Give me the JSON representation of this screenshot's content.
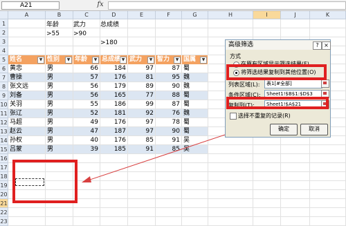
{
  "formula_bar": {
    "cell_ref": "A21",
    "fx": "fx"
  },
  "columns": [
    "A",
    "B",
    "C",
    "D",
    "E",
    "F",
    "G",
    "H",
    "I",
    "J",
    "K"
  ],
  "selected_column": "I",
  "rows": [
    "1",
    "2",
    "3",
    "4",
    "5",
    "6",
    "7",
    "8",
    "9",
    "10",
    "11",
    "12",
    "13",
    "14",
    "15",
    "16",
    "17",
    "18",
    "19",
    "20",
    "21",
    "22",
    "23"
  ],
  "selected_row": "21",
  "criteria": {
    "age_label": "年龄",
    "force_label": "武力",
    "total_label": "总成绩",
    "age_value": ">55",
    "force_value": ">90",
    "total_value": ">180"
  },
  "table": {
    "headers": [
      "姓名",
      "性别",
      "年龄",
      "总成绩",
      "武力",
      "智力",
      "国属"
    ],
    "rows": [
      [
        "黄忠",
        "男",
        "66",
        "184",
        "97",
        "87",
        "蜀"
      ],
      [
        "曹操",
        "男",
        "57",
        "176",
        "81",
        "95",
        "魏"
      ],
      [
        "张文远",
        "男",
        "56",
        "179",
        "89",
        "90",
        "魏"
      ],
      [
        "刘备",
        "男",
        "56",
        "165",
        "77",
        "88",
        "蜀"
      ],
      [
        "关羽",
        "男",
        "55",
        "186",
        "99",
        "87",
        "蜀"
      ],
      [
        "张辽",
        "男",
        "52",
        "181",
        "92",
        "76",
        "魏"
      ],
      [
        "马超",
        "男",
        "49",
        "176",
        "97",
        "78",
        "蜀"
      ],
      [
        "赵云",
        "男",
        "47",
        "187",
        "97",
        "90",
        "蜀"
      ],
      [
        "孙权",
        "男",
        "40",
        "176",
        "85",
        "91",
        "吴"
      ],
      [
        "吕蒙",
        "男",
        "39",
        "185",
        "91",
        "85",
        "吴"
      ]
    ]
  },
  "dialog": {
    "title": "高级筛选",
    "help": "?",
    "close": "×",
    "method_label": "方式",
    "option1": "在原有区域显示筛选结果(F)",
    "option2": "将筛选结果复制到其他位置(O)",
    "list_range_label": "列表区域(L):",
    "list_range_value": "表1[#全部]",
    "criteria_range_label": "条件区域(C):",
    "criteria_range_value": "Sheet1!$B$1:$D$3",
    "copy_to_label": "复制到(T):",
    "copy_to_value": "Sheet1!$A$21",
    "unique_label": "选择不重复的记录(R)",
    "ok": "确定",
    "cancel": "取消"
  },
  "colors": {
    "header_fill": "#f4a261",
    "band_fill": "#dce6f2",
    "highlight": "#e02020"
  }
}
